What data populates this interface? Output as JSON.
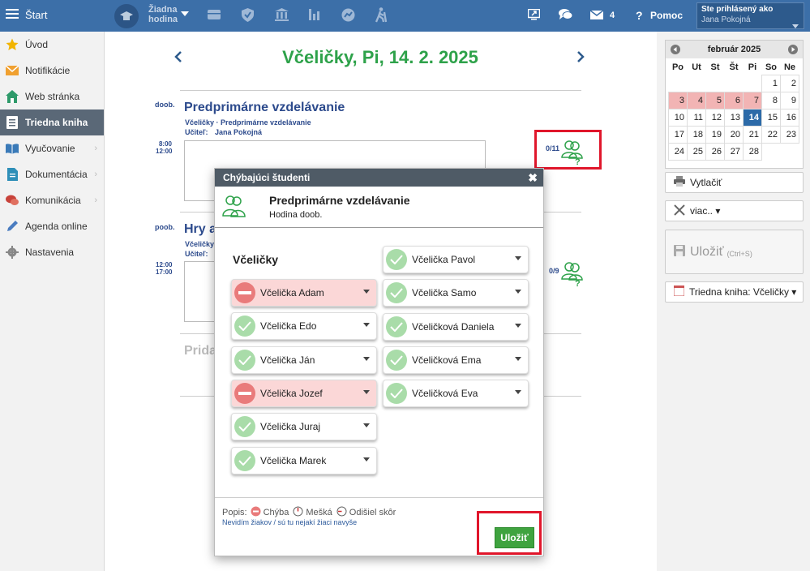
{
  "topbar": {
    "start_label": "Štart",
    "lesson_label_line1": "Žiadna",
    "lesson_label_line2": "hodina",
    "mail_count": "4",
    "help_label": "Pomoc",
    "logged_in_label": "Ste prihlásený ako",
    "user_name": "Jana Pokojná"
  },
  "sidebar": {
    "items": [
      {
        "label": "Úvod",
        "icon": "star-icon"
      },
      {
        "label": "Notifikácie",
        "icon": "envelope-icon"
      },
      {
        "label": "Web stránka",
        "icon": "home-icon"
      },
      {
        "label": "Triedna kniha",
        "icon": "book-icon"
      },
      {
        "label": "Vyučovanie",
        "icon": "open-book-icon"
      },
      {
        "label": "Dokumentácia",
        "icon": "document-icon"
      },
      {
        "label": "Komunikácia",
        "icon": "chat-icon"
      },
      {
        "label": "Agenda online",
        "icon": "pen-icon"
      },
      {
        "label": "Nastavenia",
        "icon": "gear-icon"
      }
    ]
  },
  "main": {
    "title": "Včeličky, Pi, 14. 2. 2025",
    "lesson1": {
      "tag": "doob.",
      "title": "Predprimárne vzdelávanie",
      "subtitle": "Včeličky · Predprimárne vzdelávanie",
      "teacher_label": "Učiteľ:",
      "teacher": "Jana Pokojná",
      "time_start": "8:00",
      "time_end": "12:00",
      "attendance": "0/11"
    },
    "lesson2": {
      "tag": "poob.",
      "title_partial": "Hry a",
      "subtitle_partial": "Včeličky",
      "teacher_label": "Učiteľ:",
      "time_start": "12:00",
      "time_end": "17:00",
      "attendance": "0/9"
    },
    "add_partial": "Prida"
  },
  "calendar": {
    "month": "február 2025",
    "weekdays": [
      "Po",
      "Ut",
      "St",
      "Št",
      "Pi",
      "So",
      "Ne"
    ],
    "weeks": [
      [
        "",
        "",
        "",
        "",
        "",
        "1",
        "2"
      ],
      [
        "3",
        "4",
        "5",
        "6",
        "7",
        "8",
        "9"
      ],
      [
        "10",
        "11",
        "12",
        "13",
        "14",
        "15",
        "16"
      ],
      [
        "17",
        "18",
        "19",
        "20",
        "21",
        "22",
        "23"
      ],
      [
        "24",
        "25",
        "26",
        "27",
        "28",
        "",
        ""
      ]
    ],
    "today": "14"
  },
  "right_panel": {
    "print_label": "Vytlačiť",
    "more_label": "viac.. ▾",
    "save_label": "Uložiť",
    "save_shortcut": "(Ctrl+S)",
    "classbook_label": "Triedna kniha: Včeličky ▾"
  },
  "modal": {
    "title": "Chýbajúci študenti",
    "lesson_name": "Predprimárne vzdelávanie",
    "lesson_sub": "Hodina doob.",
    "class_name": "Včeličky",
    "students_left": [
      {
        "name": "Včelička Adam",
        "status": "absent"
      },
      {
        "name": "Včelička Edo",
        "status": "present"
      },
      {
        "name": "Včelička Ján",
        "status": "present"
      },
      {
        "name": "Včelička Jozef",
        "status": "absent"
      },
      {
        "name": "Včelička Juraj",
        "status": "present"
      },
      {
        "name": "Včelička Marek",
        "status": "present"
      }
    ],
    "students_right": [
      {
        "name": "Včelička Pavol",
        "status": "present"
      },
      {
        "name": "Včelička Samo",
        "status": "present"
      },
      {
        "name": "Včeličková Daniela",
        "status": "present"
      },
      {
        "name": "Včeličková Ema",
        "status": "present"
      },
      {
        "name": "Včeličková Eva",
        "status": "present"
      }
    ],
    "legend_label": "Popis:",
    "legend_absent": "Chýba",
    "legend_late": "Mešká",
    "legend_left": "Odišiel skôr",
    "missing_students_link": "Nevidím žiakov / sú tu nejakí žiaci navyše",
    "save_button": "Uložiť"
  },
  "colors": {
    "topbar": "#3c6fa8",
    "title_green": "#2ea24a",
    "absent_red": "#e97b7b",
    "present_green": "#8fd08f",
    "highlight_red": "#e0162b",
    "save_green": "#3fa33f"
  }
}
